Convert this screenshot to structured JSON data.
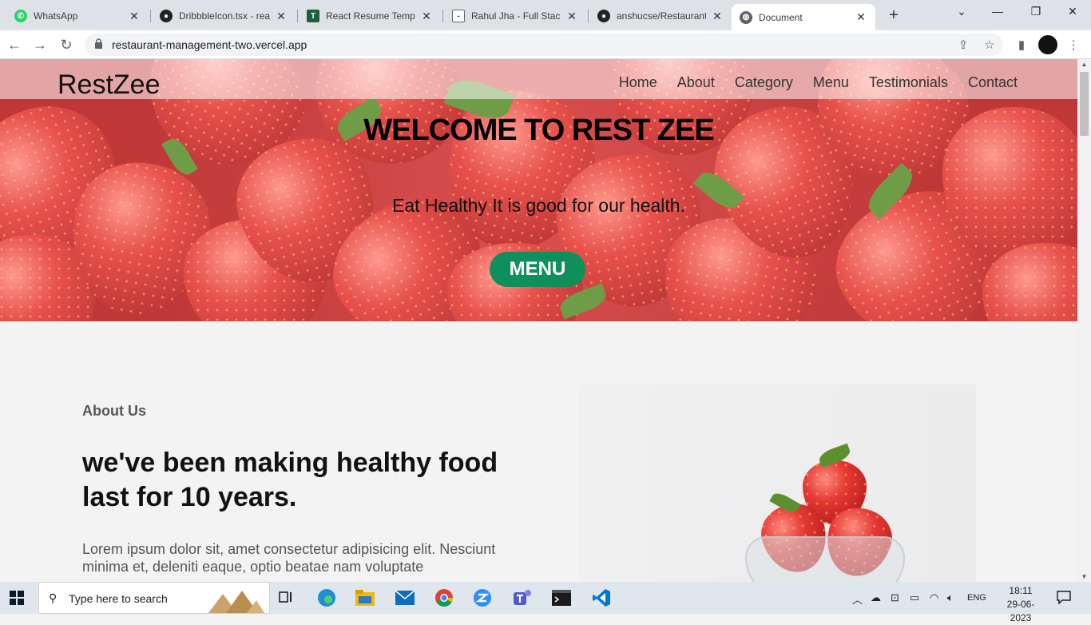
{
  "browser": {
    "tabs": [
      {
        "title": "WhatsApp",
        "icon": "whatsapp-icon"
      },
      {
        "title": "DribbbleIcon.tsx - reac",
        "icon": "github-icon"
      },
      {
        "title": "React Resume Templa",
        "icon": "tb-icon"
      },
      {
        "title": "Rahul Jha - Full Stack",
        "icon": "site-icon"
      },
      {
        "title": "anshucse/Restaurant_",
        "icon": "github-icon"
      },
      {
        "title": "Document",
        "icon": "globe-icon",
        "active": true
      }
    ],
    "url": "restaurant-management-two.vercel.app"
  },
  "site": {
    "brand": "RestZee",
    "nav": [
      "Home",
      "About",
      "Category",
      "Menu",
      "Testimonials",
      "Contact"
    ],
    "hero": {
      "title": "WELCOME TO REST ZEE",
      "subtitle": "Eat Healthy It is good for our health.",
      "button": "MENU"
    },
    "about": {
      "label": "About Us",
      "heading": "we've been making healthy food last for 10 years.",
      "text": "Lorem ipsum dolor sit, amet consectetur adipisicing elit. Nesciunt minima et, deleniti eaque, optio beatae nam voluptate"
    }
  },
  "taskbar": {
    "search_placeholder": "Type here to search",
    "language": "ENG",
    "time": "18:11",
    "date": "29-06-2023"
  },
  "colors": {
    "menu_button": "#0f8f5c",
    "hero_red": "#c62828",
    "whatsapp_green": "#25d366"
  }
}
